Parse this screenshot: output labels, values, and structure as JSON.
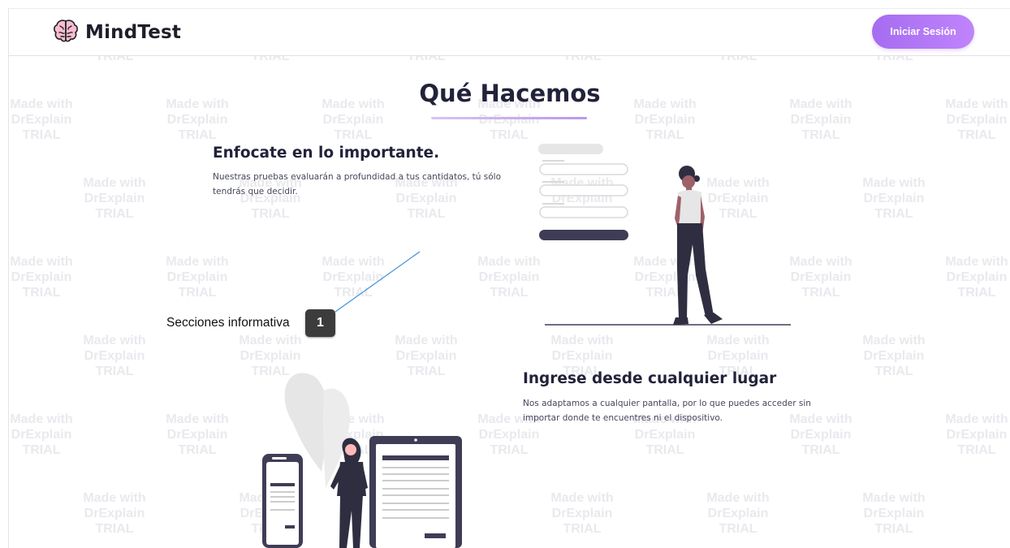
{
  "app": {
    "brand_name": "MindTest",
    "brand_icon": "brain-icon",
    "login_label": "Iniciar Sesión"
  },
  "main": {
    "title": "Qué Hacemos",
    "features": [
      {
        "title": "Enfocate en lo importante.",
        "description": "Nuestras pruebas evaluarán a profundidad a tus cantidatos, tú sólo tendrás que decidir."
      },
      {
        "title": "Ingrese desde cualquier lugar",
        "description": "Nos adaptamos a cualquier pantalla, por lo que puedes acceder sin importar donde te encuentres ni el dispositivo."
      }
    ]
  },
  "annotation": {
    "label": "Secciones informativa",
    "badge": "1"
  },
  "watermark_text": [
    "Made with",
    "DrExplain",
    "TRIAL"
  ],
  "colors": {
    "accent": "#b07af2",
    "heading": "#22223a",
    "illustration_dark": "#3f3d56"
  }
}
